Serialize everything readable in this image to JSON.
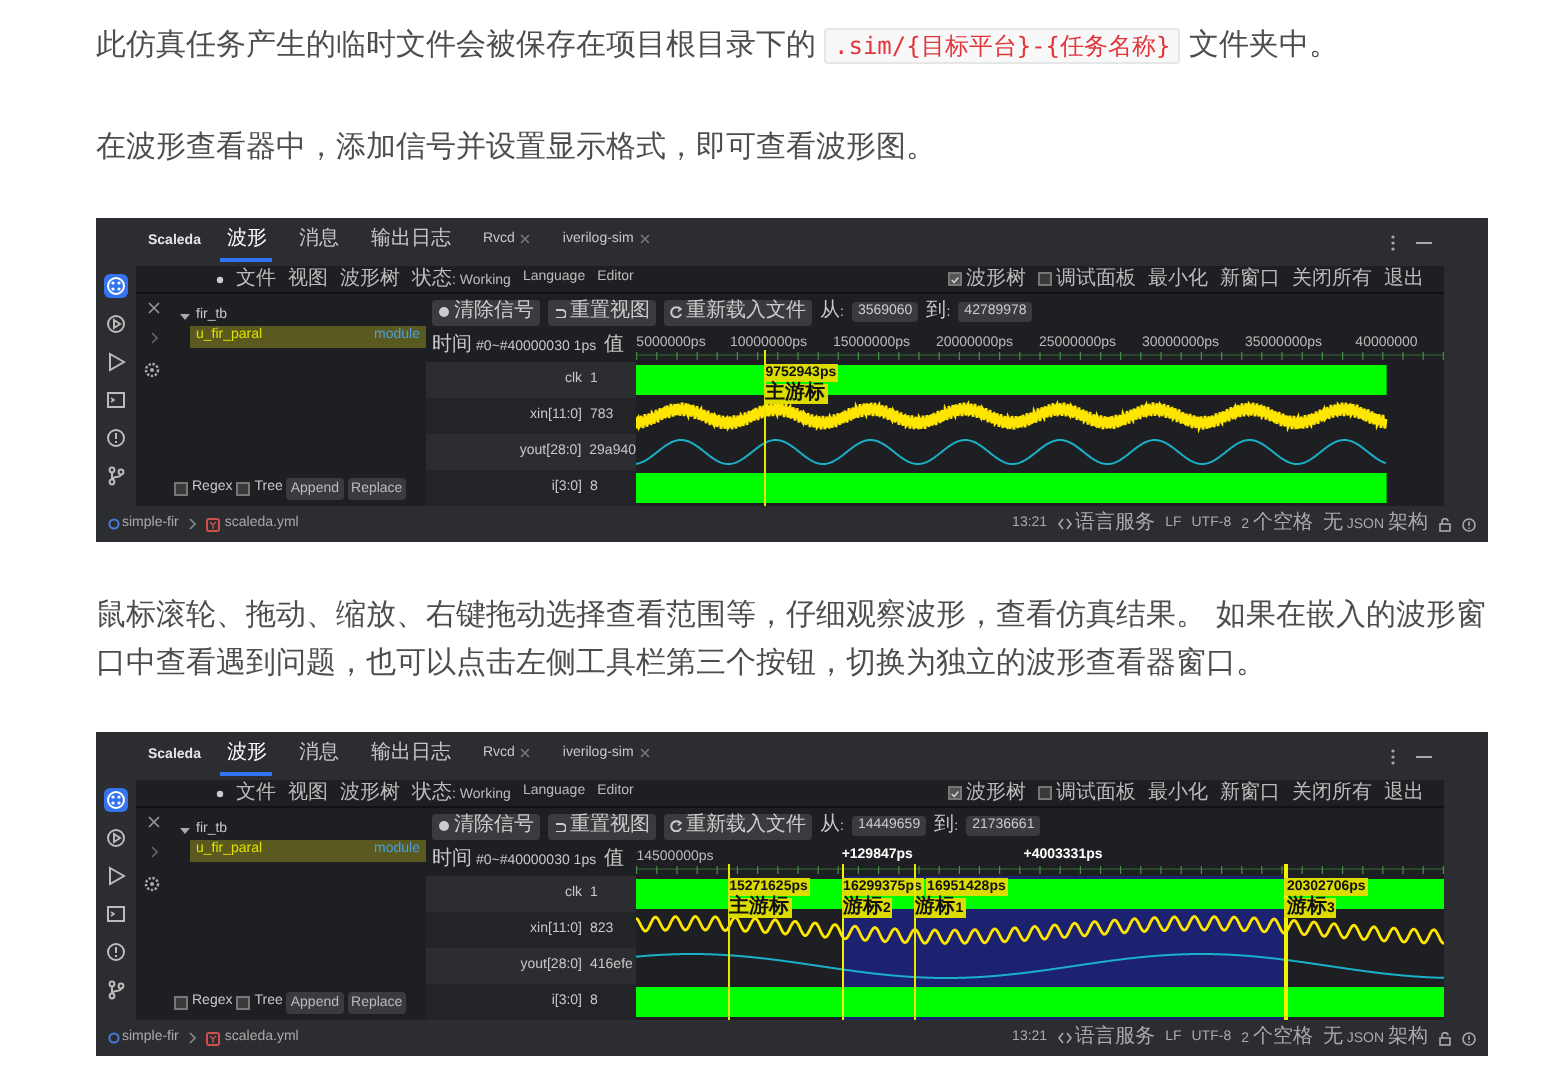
{
  "paragraphs": [
    {
      "before": "此仿真任务产生的临时文件会被保存在项目根目录下的",
      "code": ".sim/{目标平台}-{任务名称}",
      "after": "文件夹中。"
    },
    {
      "before": "在波形查看器中，添加信号并设置显示格式，即可查看波形图。"
    }
  ],
  "screenshots": [
    {
      "app_title": "Scaleda",
      "tabs": [
        {
          "label": "波形",
          "selected": true,
          "closable": false
        },
        {
          "label": "消息",
          "selected": false,
          "closable": false
        },
        {
          "label": "输出日志",
          "selected": false,
          "closable": false
        },
        {
          "label": "Rvcd",
          "selected": false,
          "closable": true
        },
        {
          "label": "iverilog-sim",
          "selected": false,
          "closable": true
        }
      ],
      "activity_bar": [
        {
          "kind": "extensions",
          "selected": true
        },
        {
          "kind": "debug",
          "selected": false
        },
        {
          "kind": "run",
          "selected": false
        },
        {
          "kind": "terminal",
          "selected": false
        },
        {
          "kind": "problems",
          "selected": false
        },
        {
          "kind": "source-control",
          "selected": false
        }
      ],
      "menu": [
        "文件",
        "视图",
        "波形树",
        "状态: Working",
        "Language",
        "Editor"
      ],
      "options": [
        {
          "label": "波形树",
          "kind": "checkbox",
          "checked": true
        },
        {
          "label": "调试面板",
          "kind": "checkbox",
          "checked": false
        },
        {
          "label": "最小化",
          "kind": "action"
        },
        {
          "label": "新窗口",
          "kind": "action"
        },
        {
          "label": "关闭所有",
          "kind": "action"
        },
        {
          "label": "退出",
          "kind": "action"
        }
      ],
      "tree": [
        {
          "label": "fir_tb",
          "expanded": true,
          "selected": false,
          "children": [
            {
              "label": "u_fir_paral",
              "type": "module",
              "selected": true
            }
          ]
        }
      ],
      "search_options": [
        {
          "label": "Regex",
          "checked": false
        },
        {
          "label": "Tree",
          "checked": false
        }
      ],
      "search_buttons": [
        "Append",
        "Replace"
      ],
      "toolbar": [
        {
          "label": "清除信号",
          "kind": "clear"
        },
        {
          "label": "重置视图",
          "kind": "reset"
        },
        {
          "label": "重新载入文件",
          "kind": "reload"
        }
      ],
      "range": {
        "from_label": "从:",
        "from": "3569060",
        "to_label": "到:",
        "to": "42789978"
      },
      "time_header": "时间 #0~#40000030 1ps",
      "value_header": "值",
      "ticks": [
        "5000000ps",
        "10000000ps",
        "15000000ps",
        "20000000ps",
        "25000000ps",
        "30000000ps",
        "35000000ps",
        "40000000"
      ],
      "signals": [
        {
          "name": "clk",
          "value": "1",
          "kind": "digital",
          "color": "#00ff00"
        },
        {
          "name": "xin[11:0]",
          "value": "783",
          "kind": "mixed",
          "color": "#ffe600"
        },
        {
          "name": "yout[28:0]",
          "value": "29a940",
          "kind": "analog",
          "color": "#1ab0c8"
        },
        {
          "name": "i[3:0]",
          "value": "8",
          "kind": "digital",
          "color": "#00ff00"
        }
      ],
      "cursors": [
        {
          "time": "9752943ps",
          "name": "主游标",
          "range_edge": false
        }
      ],
      "status": {
        "project": "simple-fir",
        "file": "scaleda.yml",
        "items": [
          "13:21",
          "语言服务",
          "LF",
          "UTF-8",
          "2 个空格",
          "无 JSON 架构"
        ]
      }
    },
    {
      "app_title": "Scaleda",
      "tabs": [
        {
          "label": "波形",
          "selected": true,
          "closable": false
        },
        {
          "label": "消息",
          "selected": false,
          "closable": false
        },
        {
          "label": "输出日志",
          "selected": false,
          "closable": false
        },
        {
          "label": "Rvcd",
          "selected": false,
          "closable": true
        },
        {
          "label": "iverilog-sim",
          "selected": false,
          "closable": true
        }
      ],
      "activity_bar": [
        {
          "kind": "extensions",
          "selected": true
        },
        {
          "kind": "debug",
          "selected": false
        },
        {
          "kind": "run",
          "selected": false
        },
        {
          "kind": "terminal",
          "selected": false
        },
        {
          "kind": "problems",
          "selected": false
        },
        {
          "kind": "source-control",
          "selected": false
        }
      ],
      "menu": [
        "文件",
        "视图",
        "波形树",
        "状态: Working",
        "Language",
        "Editor"
      ],
      "options": [
        {
          "label": "波形树",
          "kind": "checkbox",
          "checked": true
        },
        {
          "label": "调试面板",
          "kind": "checkbox",
          "checked": false
        },
        {
          "label": "最小化",
          "kind": "action"
        },
        {
          "label": "新窗口",
          "kind": "action"
        },
        {
          "label": "关闭所有",
          "kind": "action"
        },
        {
          "label": "退出",
          "kind": "action"
        }
      ],
      "tree": [
        {
          "label": "fir_tb",
          "expanded": true,
          "selected": false,
          "children": [
            {
              "label": "u_fir_paral",
              "type": "module",
              "selected": true
            }
          ]
        }
      ],
      "search_options": [
        {
          "label": "Regex",
          "checked": false
        },
        {
          "label": "Tree",
          "checked": false
        }
      ],
      "search_buttons": [
        "Append",
        "Replace"
      ],
      "toolbar": [
        {
          "label": "清除信号",
          "kind": "clear"
        },
        {
          "label": "重置视图",
          "kind": "reset"
        },
        {
          "label": "重新载入文件",
          "kind": "reload"
        }
      ],
      "range": {
        "from_label": "从:",
        "from": "14449659",
        "to_label": "到:",
        "to": "21736661"
      },
      "time_header": "时间 #0~#40000030 1ps",
      "value_header": "值",
      "ticks": [
        "14500000ps"
      ],
      "signals": [
        {
          "name": "clk",
          "value": "1",
          "kind": "digital",
          "color": "#00ff00"
        },
        {
          "name": "xin[11:0]",
          "value": "823",
          "kind": "mixed",
          "color": "#ffe600"
        },
        {
          "name": "yout[28:0]",
          "value": "416efe",
          "kind": "analog",
          "color": "#1ab0c8"
        },
        {
          "name": "i[3:0]",
          "value": "8",
          "kind": "digital",
          "color": "#00ff00"
        }
      ],
      "cursors": [
        {
          "time": "15271625ps",
          "name": "主游标",
          "range_edge": false
        },
        {
          "time": "16299375ps",
          "name": "游标2",
          "range_edge": true
        },
        {
          "time": "16951428ps",
          "name": "游标1",
          "range_edge": false
        },
        {
          "time": "20302706ps",
          "name": "游标3",
          "range_edge": true
        }
      ],
      "deltas": [
        "+129847ps",
        "+4003331ps"
      ],
      "status": {
        "project": "simple-fir",
        "file": "scaleda.yml",
        "items": [
          "13:21",
          "语言服务",
          "LF",
          "UTF-8",
          "2 个空格",
          "无 JSON 架构"
        ]
      }
    }
  ],
  "after_first_screenshot": {
    "before": "鼠标滚轮、拖动、缩放、右键拖动选择查看范围等，仔细观察波形，查看仿真结果。 如果在嵌入的波形窗口中查看遇到问题，也可以点击左侧工具栏第三个按钮，切换为独立的波形查看器窗口。"
  }
}
